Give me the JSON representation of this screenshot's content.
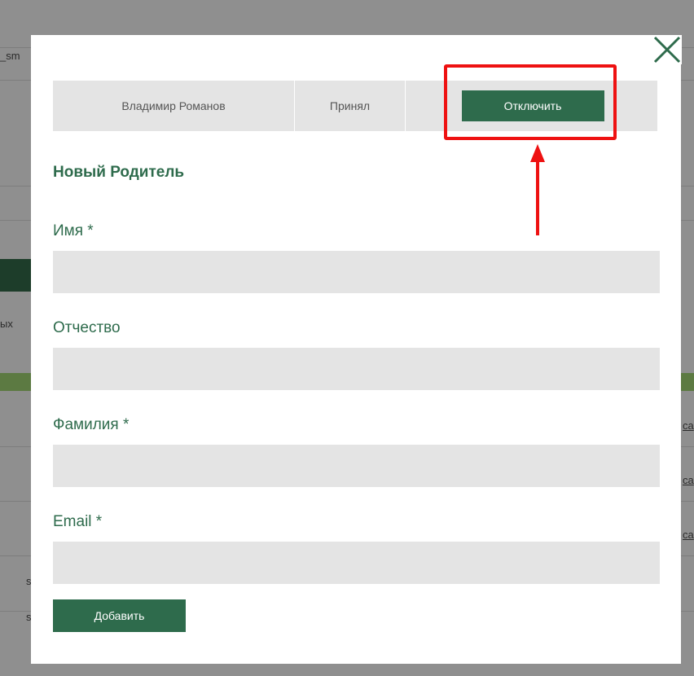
{
  "background": {
    "fragments": [
      "_sm",
      "ых"
    ],
    "links": [
      "са",
      "са",
      "са"
    ],
    "row_markers": [
      "s",
      "s"
    ]
  },
  "modal": {
    "contact": {
      "name": "Владимир Романов",
      "status": "Принял",
      "disconnect_label": "Отключить"
    },
    "form": {
      "title": "Новый Родитель",
      "fields": [
        {
          "label": "Имя *",
          "value": ""
        },
        {
          "label": "Отчество",
          "value": ""
        },
        {
          "label": "Фамилия *",
          "value": ""
        },
        {
          "label": "Email *",
          "value": ""
        }
      ],
      "submit_label": "Добавить"
    }
  },
  "colors": {
    "accent": "#2e6b4c",
    "highlight": "#ee1111",
    "field_bg": "#e4e4e4",
    "overlay": "#8f8f8f"
  },
  "icons": {
    "close": "close-icon",
    "annotation_arrow": "arrow-up-icon"
  }
}
